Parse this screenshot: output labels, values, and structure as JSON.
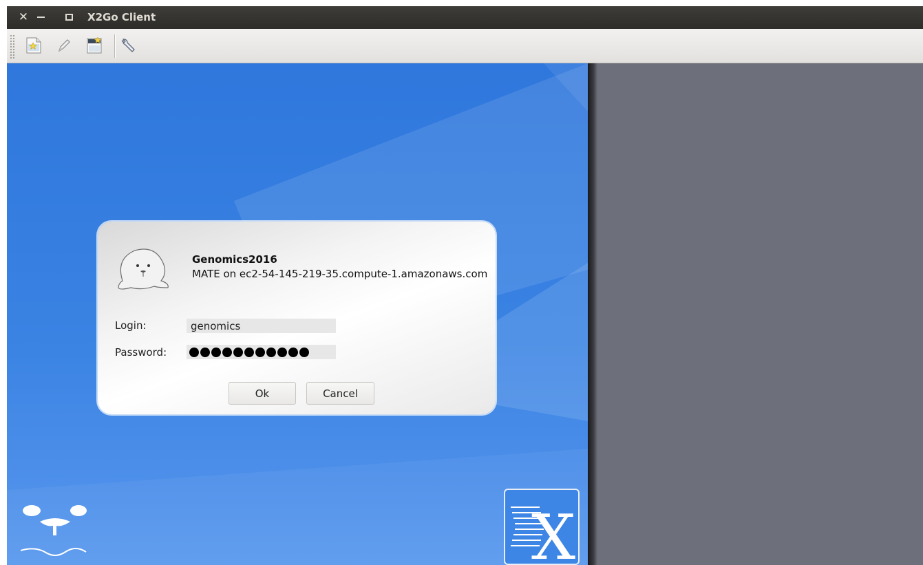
{
  "window": {
    "title": "X2Go Client"
  },
  "toolbar": {
    "items": [
      {
        "icon": "new-session-icon"
      },
      {
        "icon": "edit-session-icon"
      },
      {
        "icon": "session-export-icon"
      },
      {
        "icon": "settings-wrench-icon"
      }
    ]
  },
  "session": {
    "name": "Genomics2016",
    "description": "MATE on ec2-54-145-219-35.compute-1.amazonaws.com"
  },
  "login": {
    "label": "Login:",
    "value": "genomics"
  },
  "password": {
    "label": "Password:",
    "masked_length": 11
  },
  "buttons": {
    "ok": "Ok",
    "cancel": "Cancel"
  },
  "colors": {
    "session_background": "#3a83e3",
    "right_pane": "#6d707a",
    "titlebar": "#3c3b37"
  }
}
